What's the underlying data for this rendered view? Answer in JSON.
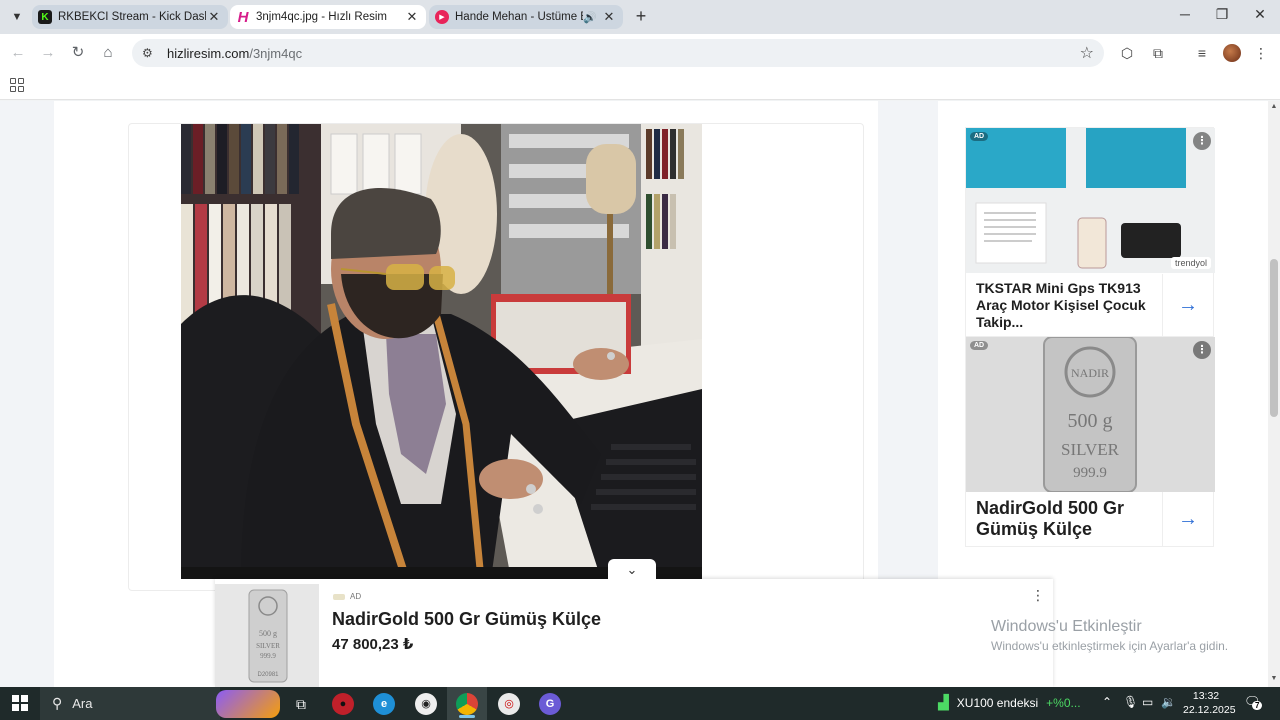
{
  "browser": {
    "tabs": [
      {
        "title": "RKBEKCI Stream - Kick Dashboard",
        "favicon": "kick-logo-icon",
        "active": false,
        "close": "✕"
      },
      {
        "title": "3njm4qc.jpg - Hızlı Resim",
        "favicon": "hizliresim-logo-icon",
        "active": true,
        "close": "✕"
      },
      {
        "title": "Hande Mehan - Üstüme Basma",
        "favicon": "youtube-music-icon",
        "active": false,
        "audio": "🔊",
        "close": "✕"
      }
    ],
    "new_tab": "+",
    "window": {
      "minimize": "─",
      "maximize": "❐",
      "close": "✕"
    },
    "url_host": "hizliresim.com",
    "url_path": "/3njm4qc",
    "icons": {
      "back": "←",
      "forward": "→",
      "reload": "↻",
      "home": "⌂",
      "site_info": "⚙",
      "star": "☆",
      "extension": "⬡",
      "puzzle": "⧉",
      "media": "≡",
      "menu": "⋮"
    }
  },
  "sidebar_ads": [
    {
      "badge": "AD",
      "title": "TKSTAR Mini Gps TK913 Araç Motor Kişisel Çocuk Takip...",
      "brand": "trendyol",
      "menu": "⋮",
      "arrow": "→"
    },
    {
      "badge": "AD",
      "title": "NadirGold 500 Gr Gümüş Külçe",
      "menu": "⋮",
      "arrow": "→"
    }
  ],
  "bar_text": {
    "bar_top": "NADIR",
    "bar_weight": "500 g",
    "bar_metal": "SILVER",
    "bar_purity": "999.9",
    "bar_serial": "D20981"
  },
  "sticky_ad": {
    "toggle": "⌄",
    "label": "AD",
    "title": "NadirGold 500 Gr Gümüş Külçe",
    "price": "47 800,23 ₺",
    "menu": "⋮"
  },
  "watermark": {
    "line1": "Windows'u Etkinleştir",
    "line2": "Windows'u etkinleştirmek için Ayarlar'a gidin."
  },
  "taskbar": {
    "search_label": "Ara",
    "ticker_name": "XU100 endeksi",
    "ticker_change": "+%0...",
    "time": "13:32",
    "date": "22.12.2025",
    "notifications": "7"
  },
  "colors": {
    "accent_blue": "#2f6fd6",
    "ticker_green": "#4cd964",
    "taskbar_bg": "#1f2a2a"
  }
}
